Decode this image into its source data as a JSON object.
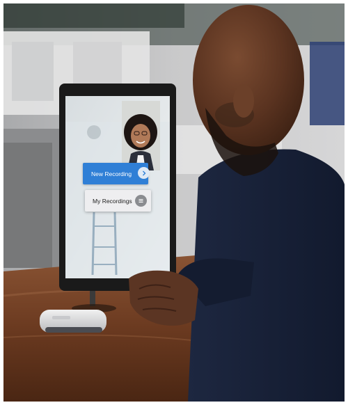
{
  "tablet_ui": {
    "new_recording_label": "New Recording",
    "my_recordings_label": "My Recordings",
    "accent_color": "#2f7fd6"
  },
  "icons": {
    "new_recording": "chevron-right-icon",
    "my_recordings": "list-icon"
  }
}
